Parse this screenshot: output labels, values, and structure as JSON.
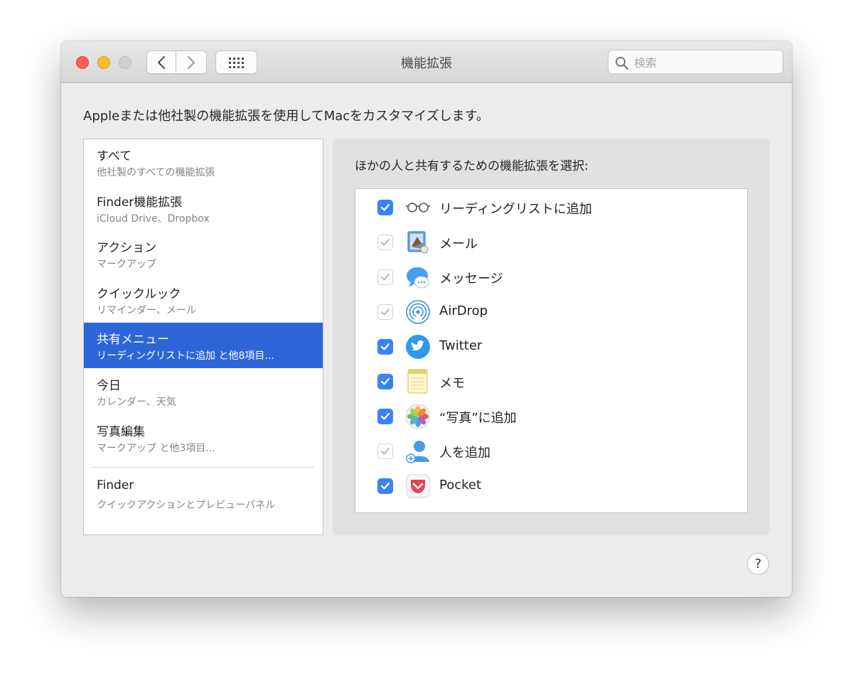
{
  "window": {
    "title": "機能拡張",
    "search_placeholder": "検索"
  },
  "description": "Appleまたは他社製の機能拡張を使用してMacをカスタマイズします。",
  "sidebar": {
    "items": [
      {
        "title": "すべて",
        "subtitle": "他社製のすべての機能拡張",
        "selected": false
      },
      {
        "title": "Finder機能拡張",
        "subtitle": "iCloud Drive、Dropbox",
        "selected": false
      },
      {
        "title": "アクション",
        "subtitle": "マークアップ",
        "selected": false
      },
      {
        "title": "クイックルック",
        "subtitle": "リマインダー、メール",
        "selected": false
      },
      {
        "title": "共有メニュー",
        "subtitle": "リーディングリストに追加 と他8項目...",
        "selected": true
      },
      {
        "title": "今日",
        "subtitle": "カレンダー、天気",
        "selected": false
      },
      {
        "title": "写真編集",
        "subtitle": "マークアップ と他3項目...",
        "selected": false
      },
      {
        "title": "Finder",
        "subtitle": "クイックアクションとプレビューパネル",
        "selected": false
      }
    ]
  },
  "panel": {
    "label": "ほかの人と共有するための機能拡張を選択:",
    "extensions": [
      {
        "label": "リーディングリストに追加",
        "checked": true,
        "enabled": true,
        "icon": "reading-list-icon"
      },
      {
        "label": "メール",
        "checked": true,
        "enabled": false,
        "icon": "mail-icon"
      },
      {
        "label": "メッセージ",
        "checked": true,
        "enabled": false,
        "icon": "messages-icon"
      },
      {
        "label": "AirDrop",
        "checked": true,
        "enabled": false,
        "icon": "airdrop-icon"
      },
      {
        "label": "Twitter",
        "checked": true,
        "enabled": true,
        "icon": "twitter-icon"
      },
      {
        "label": "メモ",
        "checked": true,
        "enabled": true,
        "icon": "notes-icon"
      },
      {
        "label": "“写真”に追加",
        "checked": true,
        "enabled": true,
        "icon": "photos-icon"
      },
      {
        "label": "人を追加",
        "checked": true,
        "enabled": false,
        "icon": "add-people-icon"
      },
      {
        "label": "Pocket",
        "checked": true,
        "enabled": true,
        "icon": "pocket-icon"
      }
    ]
  },
  "help_label": "?",
  "colors": {
    "selection": "#2c66d9",
    "checkbox": "#3b82f6",
    "close": "#fe5f57",
    "minimize": "#febc2e"
  }
}
